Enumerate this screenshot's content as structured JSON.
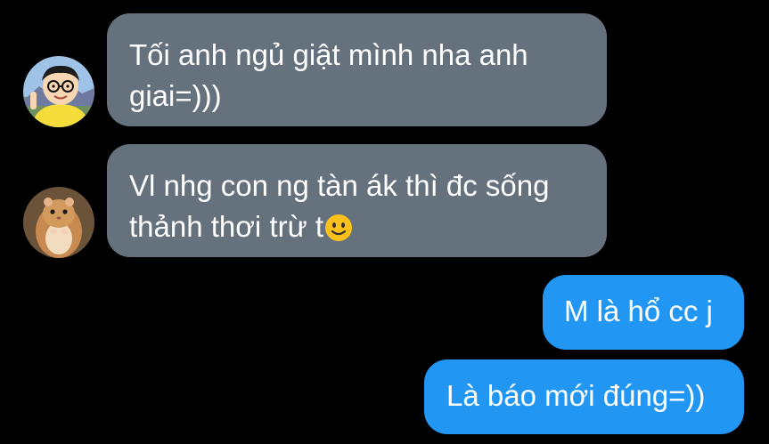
{
  "messages": [
    {
      "direction": "incoming",
      "sender": "nobita-avatar",
      "text": "Tối anh ngủ giật mình nha anh giai=)))",
      "line1": "Tối anh ngủ giật mình nha anh",
      "line2": "giai=)))"
    },
    {
      "direction": "incoming",
      "sender": "hamster-avatar",
      "text": "Vl nhg con ng tàn ák thì đc sống thảnh thơi trừ t🙂",
      "line1": "Vl nhg con ng tàn ák thì đc sống",
      "line2": "thảnh thơi trừ t",
      "emoji": "slightly-smiling-face-icon"
    },
    {
      "direction": "outgoing",
      "text": "M là hổ cc j"
    },
    {
      "direction": "outgoing",
      "text": "Là báo mới đúng=))"
    }
  ],
  "colors": {
    "background": "#000000",
    "incoming_bubble": "#65717c",
    "outgoing_bubble": "#2196f3",
    "text": "#ffffff"
  }
}
